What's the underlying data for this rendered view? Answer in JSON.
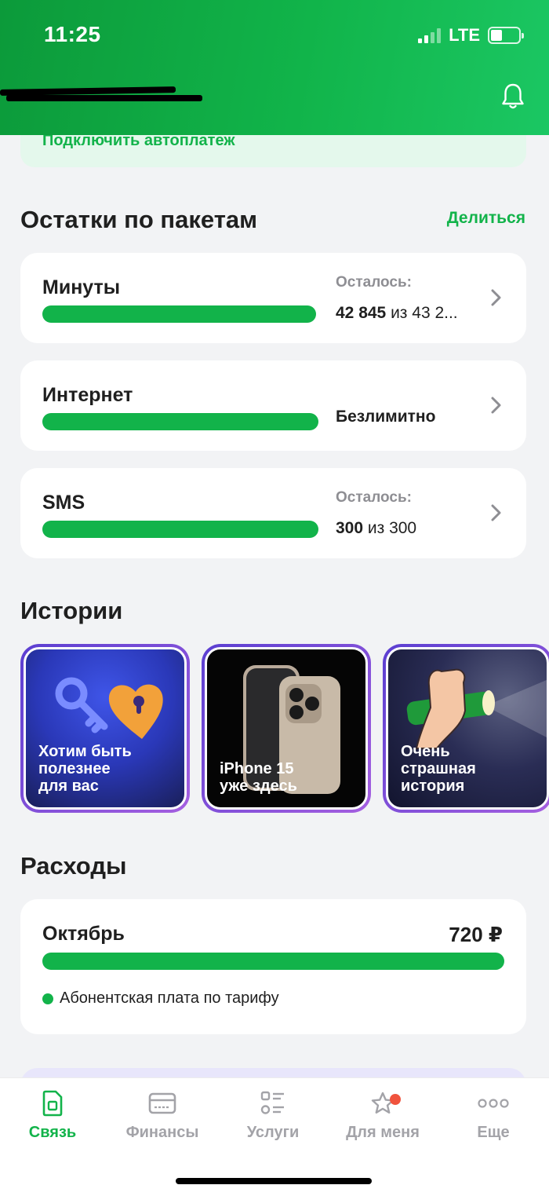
{
  "status_bar": {
    "time": "11:25",
    "network": "LTE"
  },
  "autopay": {
    "label": "Подключить автоплатеж"
  },
  "packages": {
    "title": "Остатки по пакетам",
    "share_label": "Делиться",
    "items": [
      {
        "name": "Минуты",
        "label": "Осталось:",
        "value_bold": "42 845",
        "value_rest": " из 43 2...",
        "fill": 1.0
      },
      {
        "name": "Интернет",
        "label": "",
        "value_bold": "Безлимитно",
        "value_rest": "",
        "fill": 1.0
      },
      {
        "name": "SMS",
        "label": "Осталось:",
        "value_bold": "300",
        "value_rest": " из 300",
        "fill": 1.0
      }
    ]
  },
  "stories": {
    "title": "Истории",
    "items": [
      {
        "text": "Хотим быть\nполезнее\nдля вас"
      },
      {
        "text": "iPhone 15\nуже здесь"
      },
      {
        "text": "Очень\nстрашная\nистория"
      }
    ]
  },
  "expenses": {
    "title": "Расходы",
    "month": "Октябрь",
    "amount": "720 ₽",
    "legend": "Абонентская плата по тарифу",
    "fill": 1.0
  },
  "nav": [
    {
      "label": "Связь",
      "icon": "sim-card-icon",
      "active": true
    },
    {
      "label": "Финансы",
      "icon": "wallet-icon",
      "active": false
    },
    {
      "label": "Услуги",
      "icon": "list-icon",
      "active": false
    },
    {
      "label": "Для меня",
      "icon": "star-icon",
      "active": false
    },
    {
      "label": "Еще",
      "icon": "more-icon",
      "active": false
    }
  ],
  "colors": {
    "accent": "#12b34a",
    "header": "#0c9a3a",
    "badge": "#f0533d"
  }
}
